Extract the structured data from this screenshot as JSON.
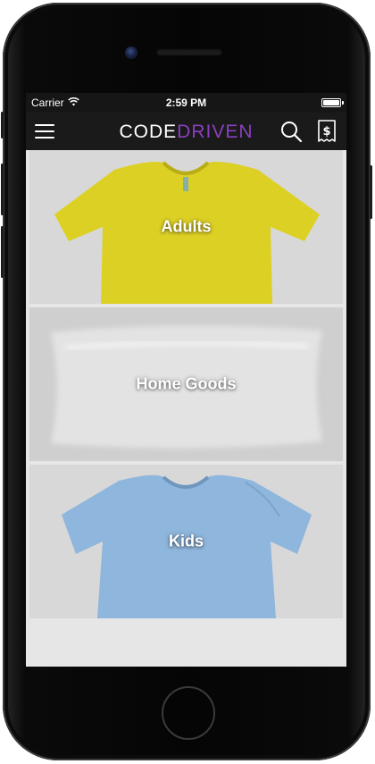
{
  "status_bar": {
    "carrier": "Carrier",
    "time": "2:59 PM",
    "battery_level": 1.0
  },
  "nav": {
    "logo_part1": "CODE",
    "logo_part2": "DRIVEN",
    "logo_color_primary": "#ffffff",
    "logo_color_accent": "#8a3fbf"
  },
  "categories": [
    {
      "label": "Adults",
      "image": "yellow-t-shirt",
      "color": "#ddd025"
    },
    {
      "label": "Home Goods",
      "image": "white-pillow",
      "color": "#e3e3e3"
    },
    {
      "label": "Kids",
      "image": "blue-baby-onesie",
      "color": "#8fb6dc"
    }
  ]
}
